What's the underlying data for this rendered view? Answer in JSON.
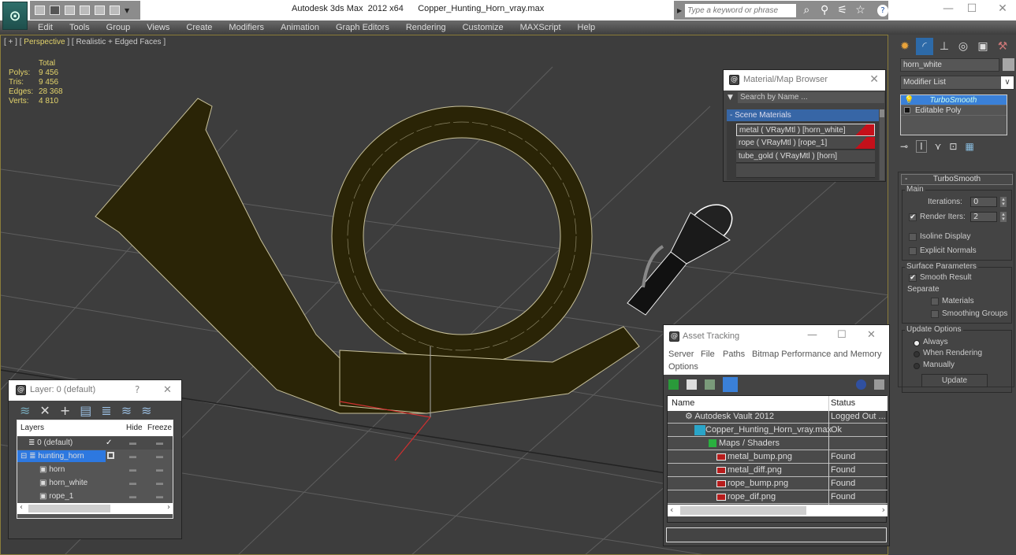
{
  "window": {
    "title": "Autodesk 3ds Max  2012 x64      Copper_Hunting_Horn_vray.max",
    "search_placeholder": "Type a keyword or phrase",
    "controls": {
      "minimize": "—",
      "maximize": "☐",
      "close": "✕"
    }
  },
  "menu": [
    "Edit",
    "Tools",
    "Group",
    "Views",
    "Create",
    "Modifiers",
    "Animation",
    "Graph Editors",
    "Rendering",
    "Customize",
    "MAXScript",
    "Help"
  ],
  "viewport": {
    "label_prefix": "[ + ] [ ",
    "label_view": "Perspective",
    "label_suffix": " ] [ Realistic + Edged Faces ]",
    "stats": {
      "header": "Total",
      "rows": [
        {
          "k": "Polys:",
          "v": "9 456"
        },
        {
          "k": "Tris:",
          "v": "9 456"
        },
        {
          "k": "Edges:",
          "v": "28 368"
        },
        {
          "k": "Verts:",
          "v": "4 810"
        }
      ]
    },
    "colors": {
      "horn": "#2a2406",
      "wire": "#c8c19a",
      "grid": "#6b6b6b",
      "frame": "#8b7d3a"
    }
  },
  "command_panel": {
    "object_name": "horn_white",
    "modifier_list": "Modifier List",
    "stack": [
      {
        "label": "TurboSmooth",
        "selected": true
      },
      {
        "label": "Editable Poly",
        "selected": false
      }
    ],
    "turbosmooth": {
      "title": "TurboSmooth",
      "main_group": "Main",
      "iterations_label": "Iterations:",
      "iterations_value": "0",
      "render_iters_label": "Render Iters:",
      "render_iters_value": "2",
      "render_iters_checked": true,
      "isoline_label": "Isoline Display",
      "explicit_normals_label": "Explicit Normals",
      "surface_group": "Surface Parameters",
      "smooth_result_label": "Smooth Result",
      "separate_label": "Separate",
      "materials_label": "Materials",
      "smoothing_groups_label": "Smoothing Groups",
      "update_group": "Update Options",
      "always_label": "Always",
      "when_rendering_label": "When Rendering",
      "manually_label": "Manually",
      "update_button": "Update"
    }
  },
  "material_browser": {
    "title": "Material/Map Browser",
    "search_placeholder": "Search by Name ...",
    "section": "- Scene Materials",
    "materials": [
      "metal  ( VRayMtl ) [horn_white]",
      "rope  ( VRayMtl ) [rope_1]",
      "tube_gold  ( VRayMtl ) [horn]"
    ]
  },
  "asset_tracking": {
    "title": "Asset Tracking",
    "menu": [
      "Server",
      "File",
      "Paths",
      "Bitmap Performance and Memory",
      "Options"
    ],
    "columns": [
      "Name",
      "Status"
    ],
    "rows": [
      {
        "name": "Autodesk Vault 2012",
        "status": "Logged Out ..."
      },
      {
        "name": "Copper_Hunting_Horn_vray.max",
        "status": "Ok"
      },
      {
        "name": "Maps / Shaders",
        "status": ""
      },
      {
        "name": "metal_bump.png",
        "status": "Found"
      },
      {
        "name": "metal_diff.png",
        "status": "Found"
      },
      {
        "name": "rope_bump.png",
        "status": "Found"
      },
      {
        "name": "rope_dif.png",
        "status": "Found"
      }
    ]
  },
  "layers": {
    "title": "Layer: 0 (default)",
    "help": "?",
    "close": "✕",
    "columns": [
      "Layers",
      "Hide",
      "Freeze"
    ],
    "rows": [
      {
        "name": "0 (default)",
        "type": "layer",
        "current": true
      },
      {
        "name": "hunting_horn",
        "type": "layer",
        "selected": true
      },
      {
        "name": "horn",
        "type": "object"
      },
      {
        "name": "horn_white",
        "type": "object"
      },
      {
        "name": "rope_1",
        "type": "object"
      }
    ]
  }
}
